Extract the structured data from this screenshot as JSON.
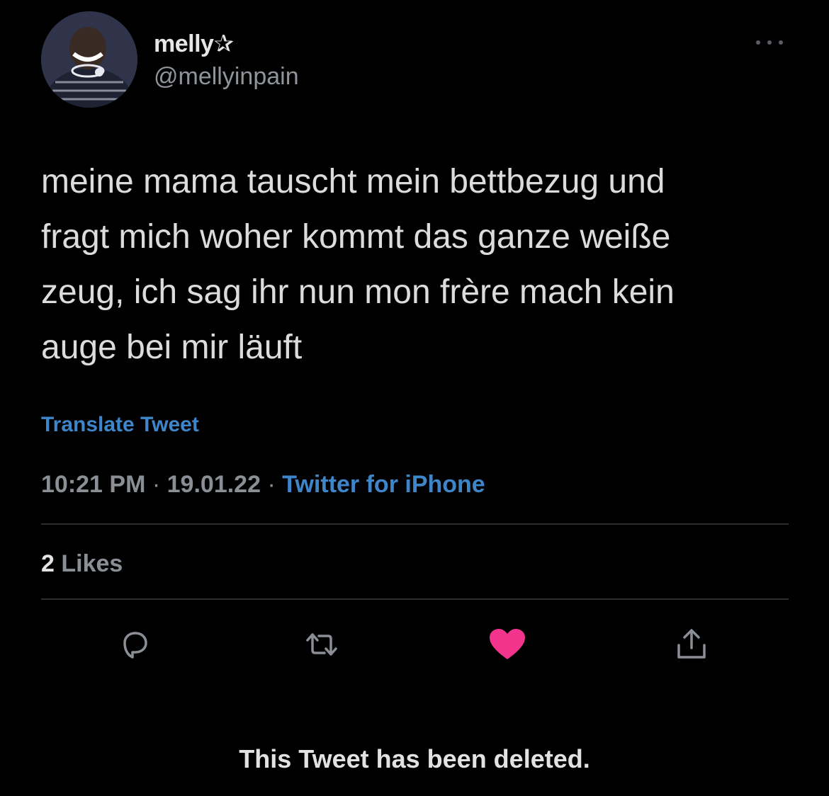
{
  "author": {
    "display_name": "melly✰",
    "handle": "@mellyinpain",
    "avatar_icon": "profile-photo"
  },
  "tweet": {
    "text": "meine mama tauscht mein bettbezug und\nfragt mich woher kommt das ganze weiße\nzeug, ich sag ihr nun mon frère mach kein\nauge bei mir läuft",
    "translate_label": "Translate Tweet",
    "time": "10:21 PM",
    "separator": "·",
    "date": "19.01.22",
    "client": "Twitter for iPhone"
  },
  "stats": {
    "likes_count": "2",
    "likes_label": "Likes"
  },
  "actions": {
    "reply_icon": "reply-icon",
    "retweet_icon": "retweet-icon",
    "like_icon": "heart-icon",
    "share_icon": "share-icon",
    "like_color": "#f2348d"
  },
  "notice": {
    "deleted_text": "This Tweet has been deleted."
  },
  "colors": {
    "background": "#000000",
    "link": "#3e86c9",
    "muted": "#8a8e95"
  }
}
